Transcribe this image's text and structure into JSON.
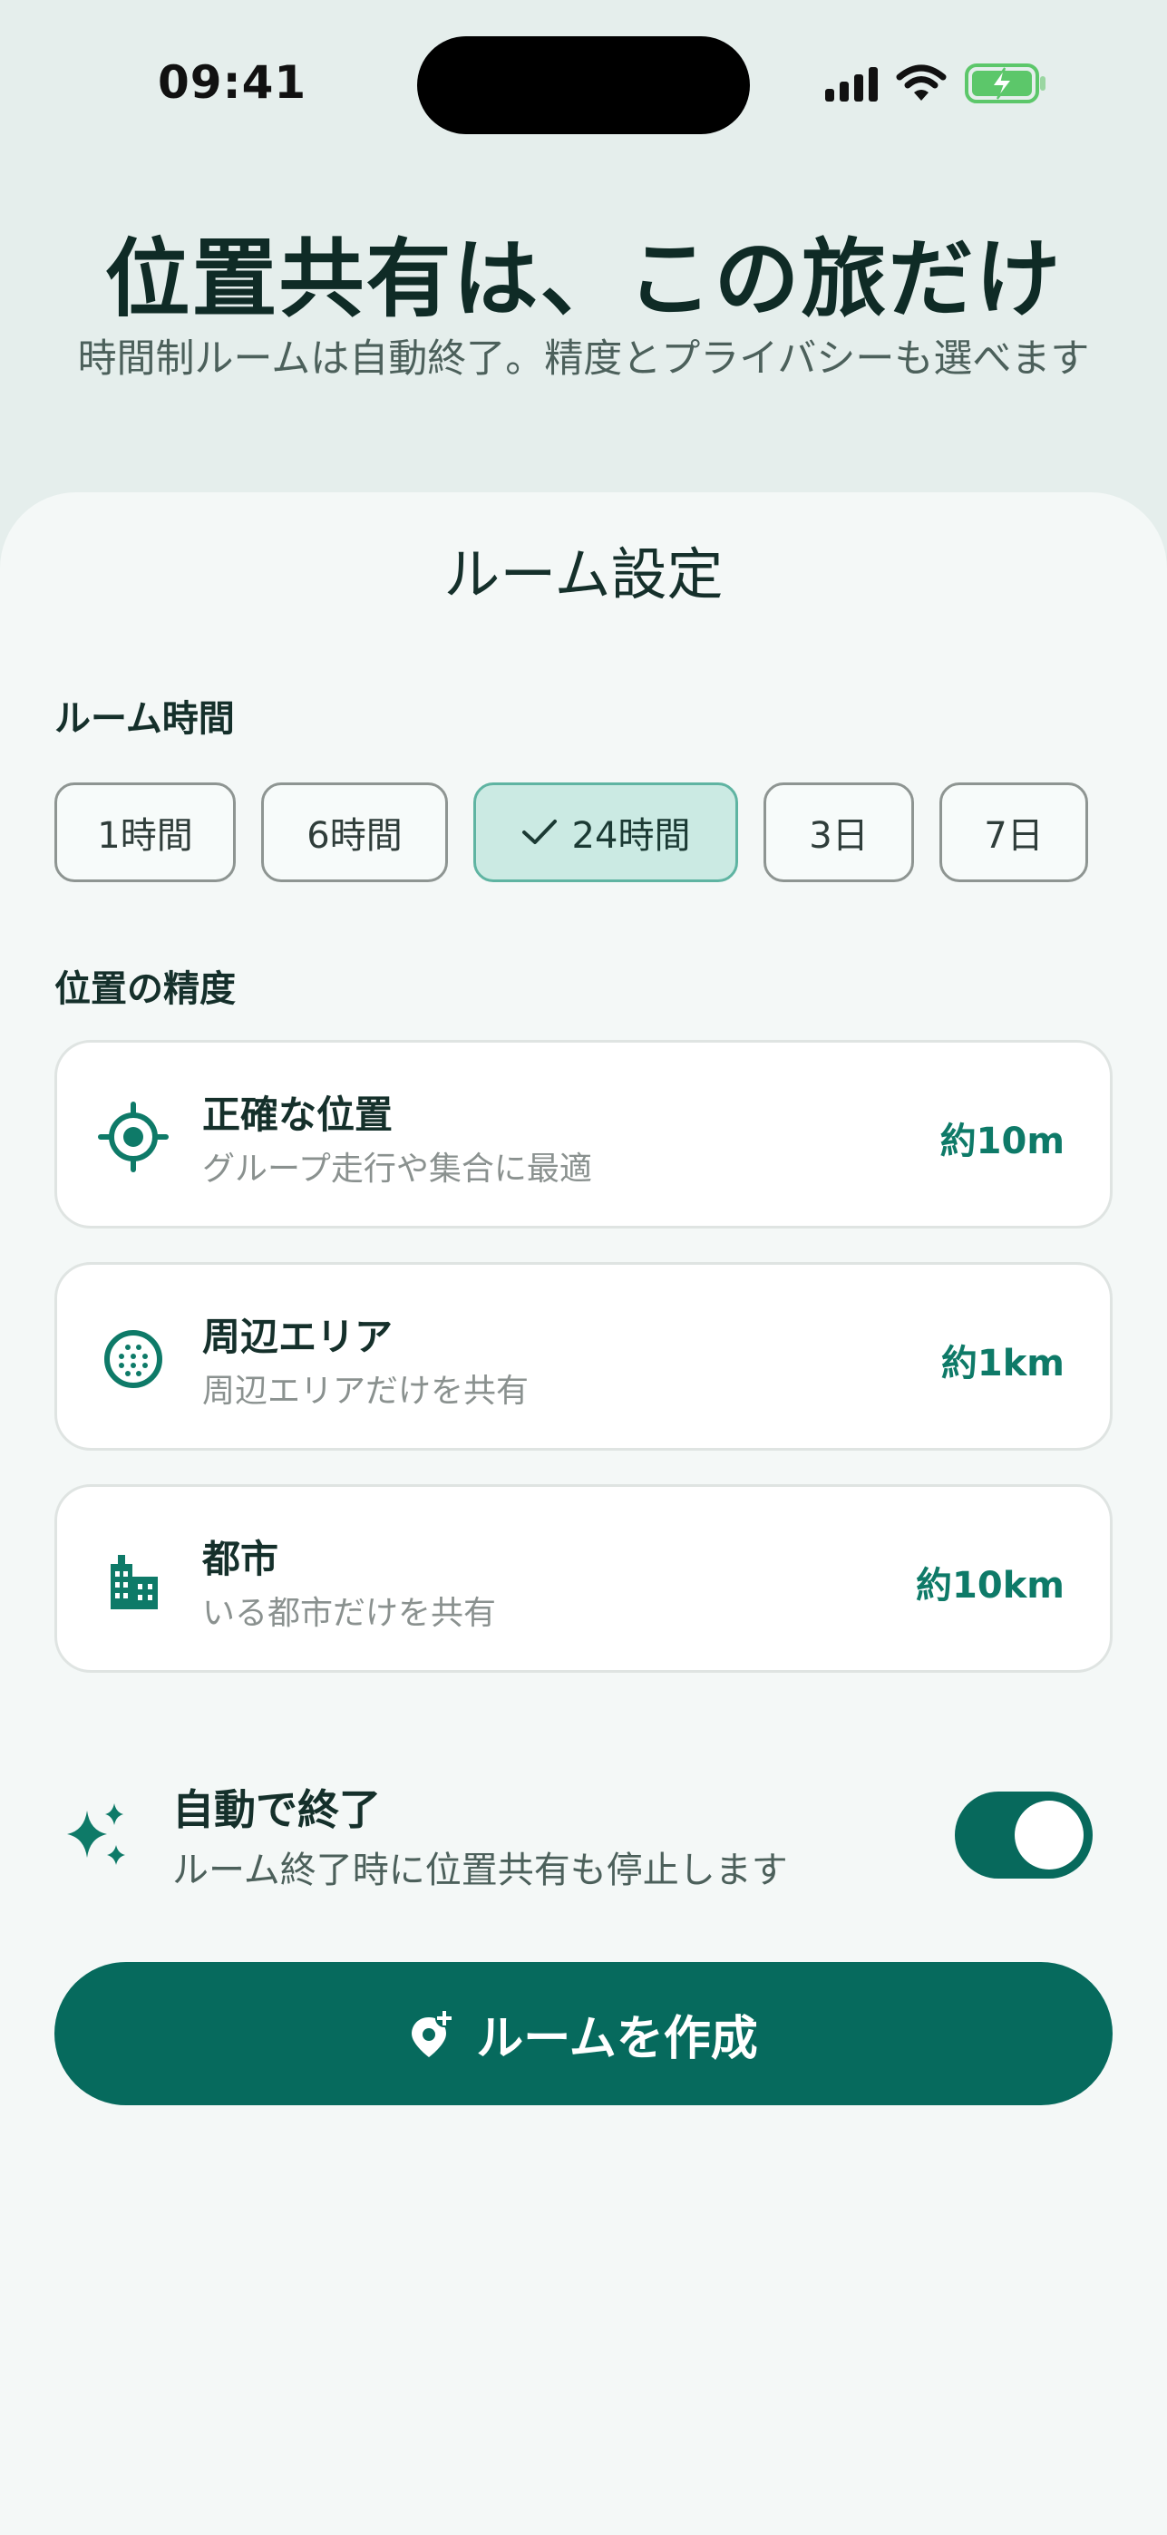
{
  "status_bar": {
    "time": "09:41"
  },
  "header": {
    "title": "位置共有は、この旅だけ",
    "subtitle": "時間制ルームは自動終了。精度とプライバシーも選べます"
  },
  "sheet": {
    "title": "ルーム設定"
  },
  "duration": {
    "label": "ルーム時間",
    "options": [
      "1時間",
      "6時間",
      "24時間",
      "3日",
      "7日"
    ],
    "selected": "24時間"
  },
  "precision": {
    "label": "位置の精度",
    "options": [
      {
        "title": "正確な位置",
        "subtitle": "グループ走行や集合に最適",
        "value": "約10m",
        "icon": "target-icon"
      },
      {
        "title": "周辺エリア",
        "subtitle": "周辺エリアだけを共有",
        "value": "約1km",
        "icon": "dotted-area-icon"
      },
      {
        "title": "都市",
        "subtitle": "いる都市だけを共有",
        "value": "約10km",
        "icon": "city-icon"
      }
    ]
  },
  "auto_end": {
    "title": "自動で終了",
    "subtitle": "ルーム終了時に位置共有も停止します",
    "enabled": true,
    "icon": "sparkle-icon"
  },
  "create_button": {
    "label": "ルームを作成",
    "icon": "add-location-icon"
  },
  "colors": {
    "accent": "#066a5d",
    "selected_chip": "#cbeae3",
    "value_text": "#0e7a68"
  }
}
